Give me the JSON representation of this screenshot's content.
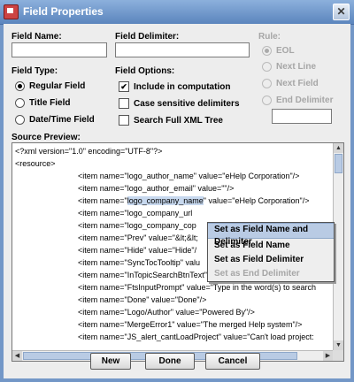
{
  "window": {
    "title": "Field Properties",
    "close_glyph": "✕"
  },
  "field_name": {
    "label": "Field Name:",
    "value": ""
  },
  "field_delimiter": {
    "label": "Field Delimiter:",
    "value": ""
  },
  "rule": {
    "label": "Rule:",
    "options": [
      "EOL",
      "Next Line",
      "Next Field",
      "End Delimiter"
    ],
    "selected": "EOL",
    "end_delimiter_value": ""
  },
  "field_type": {
    "label": "Field Type:",
    "options": [
      "Regular Field",
      "Title Field",
      "Date/Time Field"
    ],
    "selected": "Regular Field"
  },
  "field_options": {
    "label": "Field Options:",
    "items": [
      {
        "label": "Include in computation",
        "checked": true
      },
      {
        "label": "Case sensitive delimiters",
        "checked": false
      },
      {
        "label": "Search Full XML Tree",
        "checked": false
      }
    ]
  },
  "source_preview": {
    "label": "Source Preview:",
    "lines": [
      "<?xml version=\"1.0\" encoding=\"UTF-8\"?>",
      "<resource>",
      "<item name=\"logo_author_name\" value=\"eHelp Corporation\"/>",
      "<item name=\"logo_author_email\" value=\"\"/>",
      "<item name=\"logo_company_name\" value=\"eHelp Corporation\"/>",
      "<item name=\"logo_company_url",
      "<item name=\"logo_company_cop",
      "<item name=\"Prev\" value=\"&lt;&lt;",
      "<item name=\"Hide\" value=\"Hide\"/",
      "<item name=\"SyncTocTooltip\" valu",
      "<item name=\"InTopicSearchBtnText\" value=\"Go\"/>",
      "<item name=\"FtsInputPrompt\" value=\"Type in the word(s) to search",
      "<item name=\"Done\" value=\"Done\"/>",
      "<item name=\"Logo/Author\" value=\"Powered By\"/>",
      "<item name=\"MergeError1\" value=\"The merged Help system\"/>",
      "<item name=\"JS_alert_cantLoadProject\" value=\"Can't load project:"
    ]
  },
  "context_menu": {
    "items": [
      {
        "label": "Set as Field Name and Delimiter",
        "state": "selected"
      },
      {
        "label": "Set as Field Name",
        "state": "enabled"
      },
      {
        "label": "Set as Field Delimiter",
        "state": "enabled"
      },
      {
        "label": "Set as End Delimiter",
        "state": "disabled"
      }
    ]
  },
  "buttons": {
    "new": "New",
    "done": "Done",
    "cancel": "Cancel"
  },
  "icons": {
    "scroll_up": "▲",
    "scroll_down": "▼",
    "scroll_left": "◀",
    "scroll_right": "▶",
    "check": "✔"
  },
  "colors": {
    "titlebar": "#6f96c8",
    "selection": "#b9cbe4",
    "background": "#ededed"
  }
}
